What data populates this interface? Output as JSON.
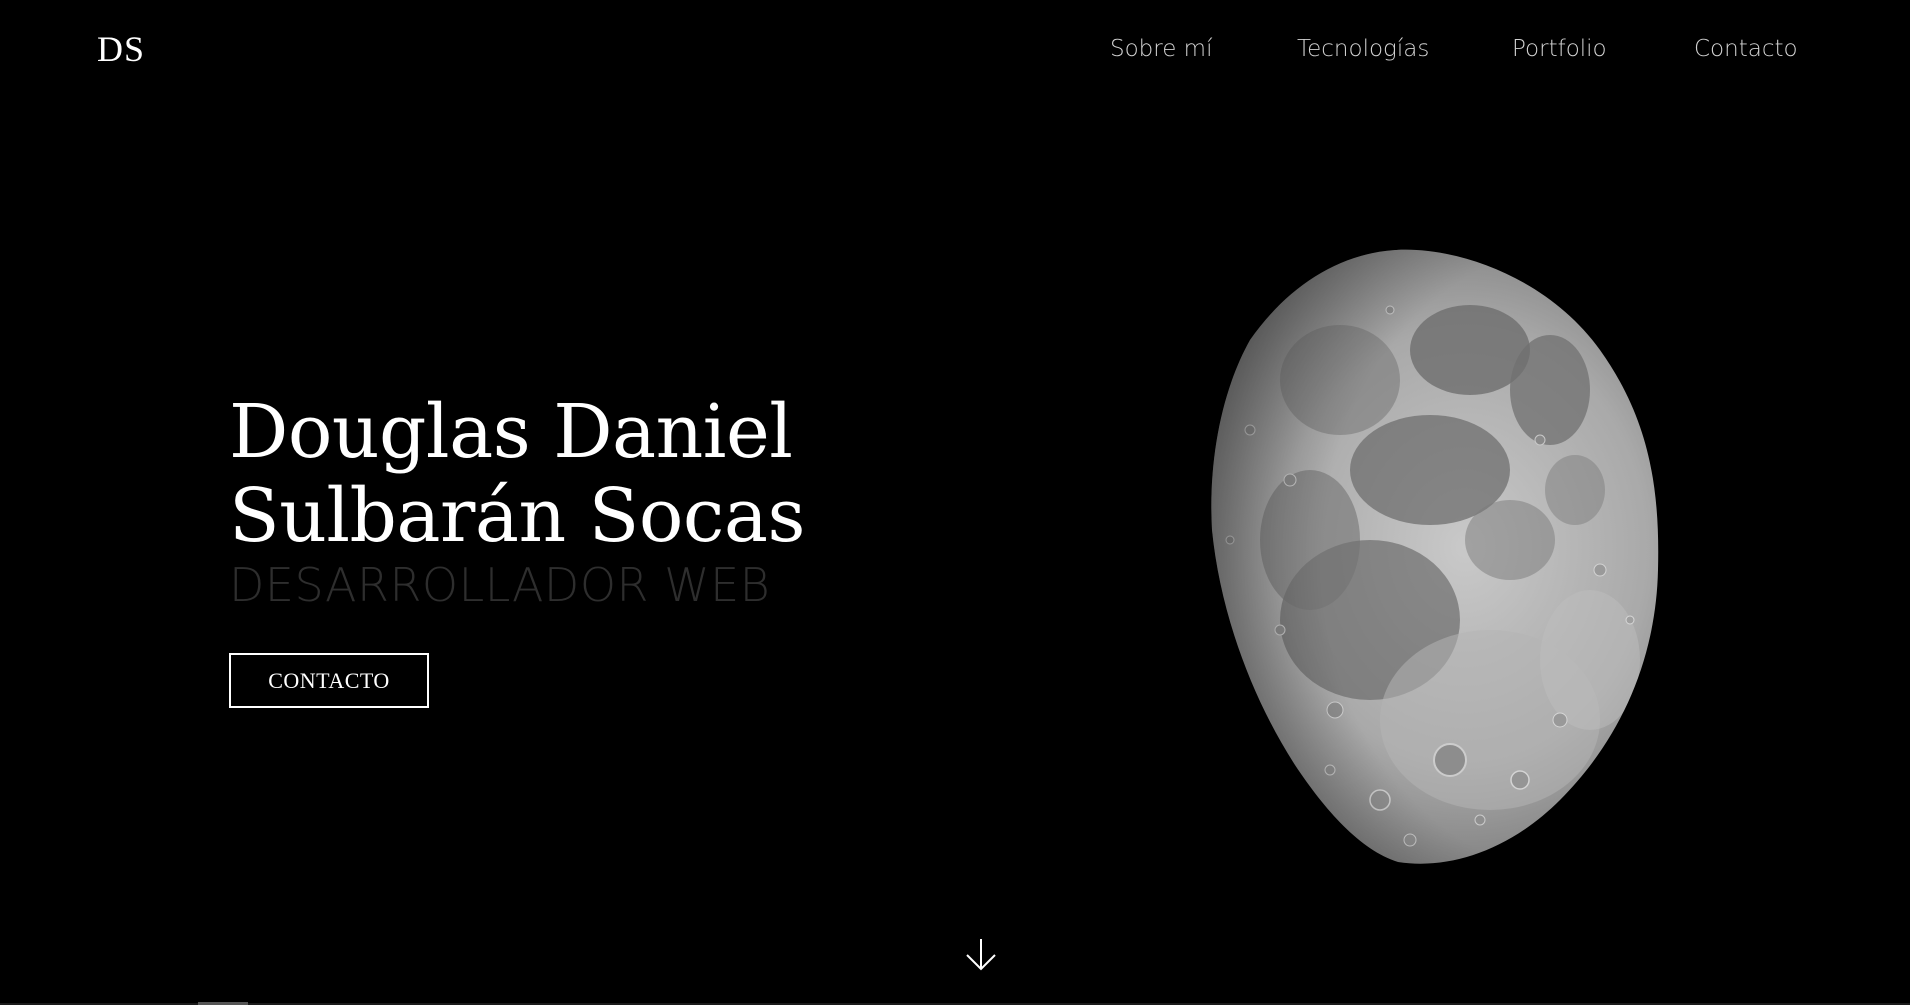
{
  "header": {
    "logo": "DS",
    "nav": [
      {
        "label": "Sobre mí"
      },
      {
        "label": "Tecnologías"
      },
      {
        "label": "Portfolio"
      },
      {
        "label": "Contacto"
      }
    ]
  },
  "hero": {
    "name_line1": "Douglas Daniel",
    "name_line2": "Sulbarán Socas",
    "role": "DESARROLLADOR WEB",
    "cta_label": "CONTACTO"
  },
  "colors": {
    "background": "#000000",
    "text": "#ffffff",
    "nav_text": "#d2d2d2",
    "role_text": "#2e2e2e"
  },
  "icons": {
    "scroll": "arrow-down-icon"
  }
}
